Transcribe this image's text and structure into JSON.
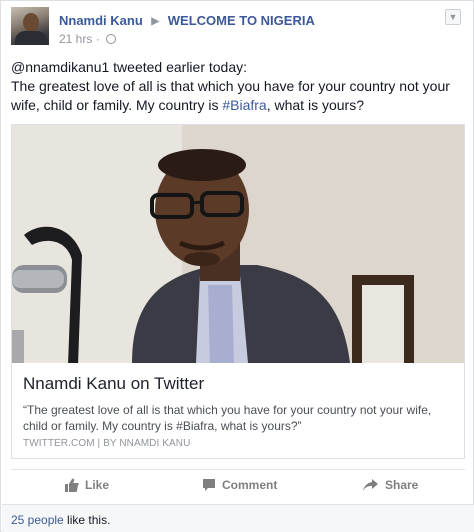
{
  "post": {
    "author": "Nnamdi Kanu",
    "target_page": "WELCOME TO NIGERIA",
    "timestamp": "21 hrs",
    "meta_separator": "·",
    "text_line1": "@nnamdikanu1 tweeted earlier today:",
    "text_line2_pre": "The greatest love of all is that which you have for your country not your wife, child or family. My country is ",
    "text_hashtag": "#Biafra",
    "text_line2_post": ", what is yours?"
  },
  "link_card": {
    "title": "Nnamdi Kanu on Twitter",
    "description": "“The greatest love of all is that which you have for your country not your wife, child or family. My country is #Biafra, what is yours?”",
    "source": "TWITTER.COM | BY NNAMDI KANU"
  },
  "actions": {
    "like_label": "Like",
    "comment_label": "Comment",
    "share_label": "Share"
  },
  "likes": {
    "count_label": "25 people",
    "suffix": " like this."
  },
  "icons": {
    "dropdown": "chevron-down-icon",
    "globe": "globe-icon",
    "like": "thumbs-up-icon",
    "comment": "comment-icon",
    "share": "share-arrow-icon"
  },
  "colors": {
    "link_blue": "#3b5998",
    "muted_gray": "#90949c",
    "action_gray": "#7f7f7f"
  }
}
